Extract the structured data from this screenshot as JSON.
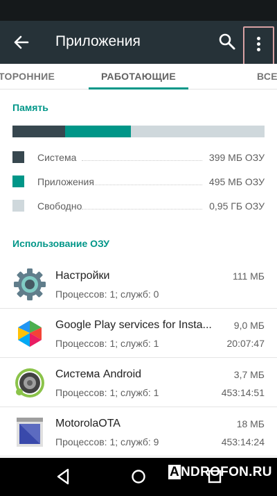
{
  "appbar": {
    "title": "Приложения"
  },
  "tabs": [
    {
      "label": "ТОРОННИЕ"
    },
    {
      "label": "РАБОТАЮЩИЕ"
    },
    {
      "label": "ВСЕ"
    }
  ],
  "memory": {
    "title": "Память",
    "bar": [
      {
        "fraction": 0.21,
        "color": "#37474f"
      },
      {
        "fraction": 0.26,
        "color": "#009688"
      },
      {
        "fraction": 0.53,
        "color": "#cfd8dc"
      }
    ],
    "legend": [
      {
        "label": "Система",
        "value": "399 МБ ОЗУ",
        "color": "#37474f"
      },
      {
        "label": "Приложения",
        "value": "495 МБ ОЗУ",
        "color": "#009688"
      },
      {
        "label": "Свободно",
        "value": "0,95 ГБ ОЗУ",
        "color": "#cfd8dc"
      }
    ]
  },
  "usage": {
    "title": "Использование ОЗУ",
    "apps": [
      {
        "name": "Настройки",
        "sub": "Процессов: 1; служб: 0",
        "size": "111 МБ",
        "time": "",
        "icon": "settings-gear-icon"
      },
      {
        "name": "Google Play services for Insta...",
        "sub": "Процессов: 1; служб: 1",
        "size": "9,0 МБ",
        "time": "20:07:47",
        "icon": "google-play-services-icon"
      },
      {
        "name": "Система Android",
        "sub": "Процессов: 1; служб: 1",
        "size": "3,7 МБ",
        "time": "453:14:51",
        "icon": "android-system-icon"
      },
      {
        "name": "MotorolaOTA",
        "sub": "Процессов: 1; служб: 9",
        "size": "18 МБ",
        "time": "453:14:24",
        "icon": "motorola-ota-icon"
      }
    ]
  },
  "watermark": {
    "a": "A",
    "rest": "NDROFON.RU"
  }
}
